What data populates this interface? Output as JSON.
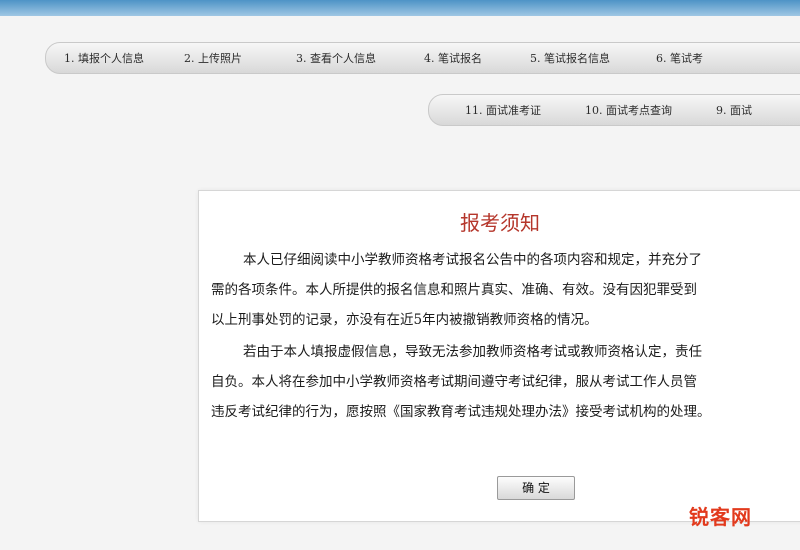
{
  "nav": {
    "row1": [
      {
        "label": "1. 填报个人信息"
      },
      {
        "label": "2. 上传照片"
      },
      {
        "label": "3. 查看个人信息"
      },
      {
        "label": "4. 笔试报名"
      },
      {
        "label": "5. 笔试报名信息"
      },
      {
        "label": "6. 笔试考"
      }
    ],
    "row2": [
      {
        "label": "11. 面试准考证"
      },
      {
        "label": "10. 面试考点查询"
      },
      {
        "label": "9. 面试"
      }
    ]
  },
  "notice": {
    "title": "报考须知",
    "lines1": [
      "本人已仔细阅读中小学教师资格考试报名公告中的各项内容和规定，并充分了",
      "需的各项条件。本人所提供的报名信息和照片真实、准确、有效。没有因犯罪受到",
      "以上刑事处罚的记录，亦没有在近5年内被撤销教师资格的情况。"
    ],
    "lines2": [
      "若由于本人填报虚假信息，导致无法参加教师资格考试或教师资格认定，责任",
      "自负。本人将在参加中小学教师资格考试期间遵守考试纪律，服从考试工作人员管",
      "违反考试纪律的行为，愿按照《国家教育考试违规处理办法》接受考试机构的处理。"
    ],
    "confirm_label": "确 定"
  },
  "watermark": "锐客网",
  "colors": {
    "title": "#b5362b",
    "watermark": "#e23a1d",
    "top_strip": "#4d93c6"
  }
}
